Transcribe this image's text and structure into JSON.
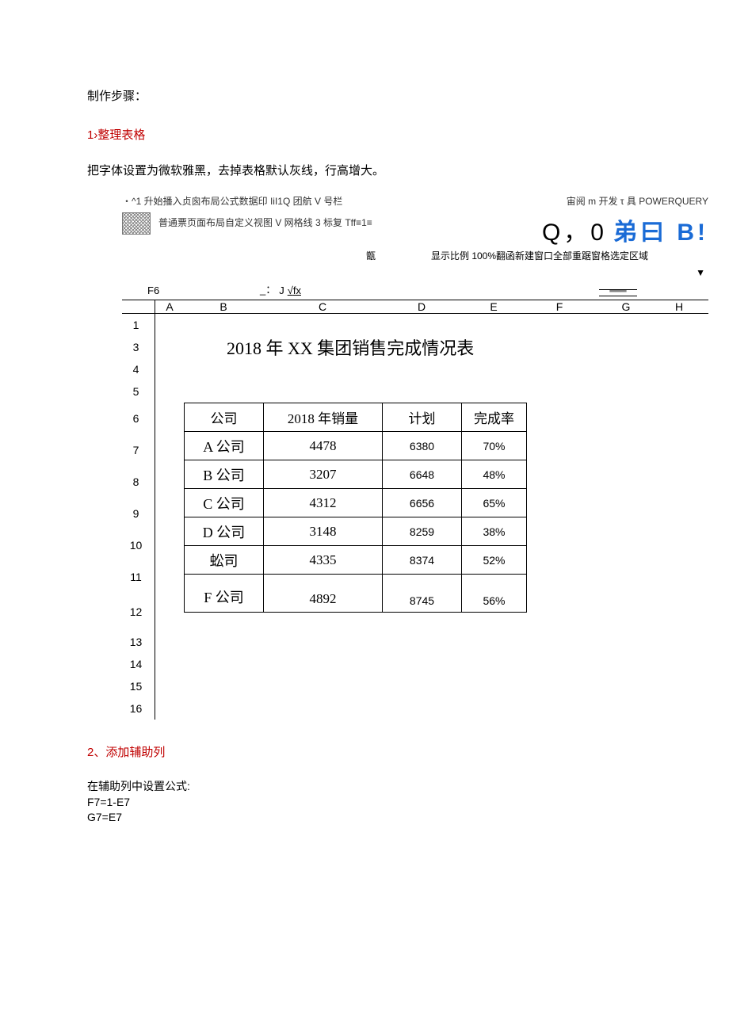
{
  "text": {
    "intro": "制作步骤：",
    "step1_title": "1›整理表格",
    "step1_desc": "把字体设置为微软雅黑，去掉表格默认灰线，行高增大。",
    "step2_title": "2、添加辅助列",
    "step2_desc": "在辅助列中设置公式:",
    "formula1": "F7=1-E7",
    "formula2": "G7=E7"
  },
  "ribbon": {
    "tabs_left": "・^1 升始播入贞囪布局公式数据印 IiI1Q 团航 V 号栏",
    "tabs_right": "宙阅 m 开发 τ 具 POWERQUERY",
    "row2_left": "普通票页面布局自定义视图 V 网格线 3 标复 Tff≡1≡",
    "big_black": "Q，0 ",
    "big_blue": "弟曰 B!",
    "row3_left_char": "甑",
    "row3_right": "显示比例 100%翻函新建窗口全部重踞窗格选定区域",
    "triangle": "▼",
    "namebox": "F6",
    "underscore_colon": "_：",
    "J": "J",
    "check": "√",
    "fx": "fx"
  },
  "cols": [
    "A",
    "B",
    "C",
    "D",
    "E",
    "F",
    "G",
    "H"
  ],
  "rows_left": [
    "1",
    "3",
    "4",
    "5",
    "6",
    "7",
    "8",
    "9",
    "10",
    "11",
    "12",
    "13",
    "14",
    "15",
    "16"
  ],
  "table": {
    "title": "2018 年 XX 集团销售完成情况表",
    "headers": [
      "公司",
      "2018 年销量",
      "计划",
      "完成率"
    ],
    "rows": [
      {
        "co": "A 公司",
        "sales": "4478",
        "plan": "6380",
        "rate": "70%"
      },
      {
        "co": "B 公司",
        "sales": "3207",
        "plan": "6648",
        "rate": "48%"
      },
      {
        "co": "C 公司",
        "sales": "4312",
        "plan": "6656",
        "rate": "65%"
      },
      {
        "co": "D 公司",
        "sales": "3148",
        "plan": "8259",
        "rate": "38%"
      },
      {
        "co": "蚣司",
        "sales": "4335",
        "plan": "8374",
        "rate": "52%"
      },
      {
        "co": "F 公司",
        "sales": "4892",
        "plan": "8745",
        "rate": "56%"
      }
    ]
  }
}
